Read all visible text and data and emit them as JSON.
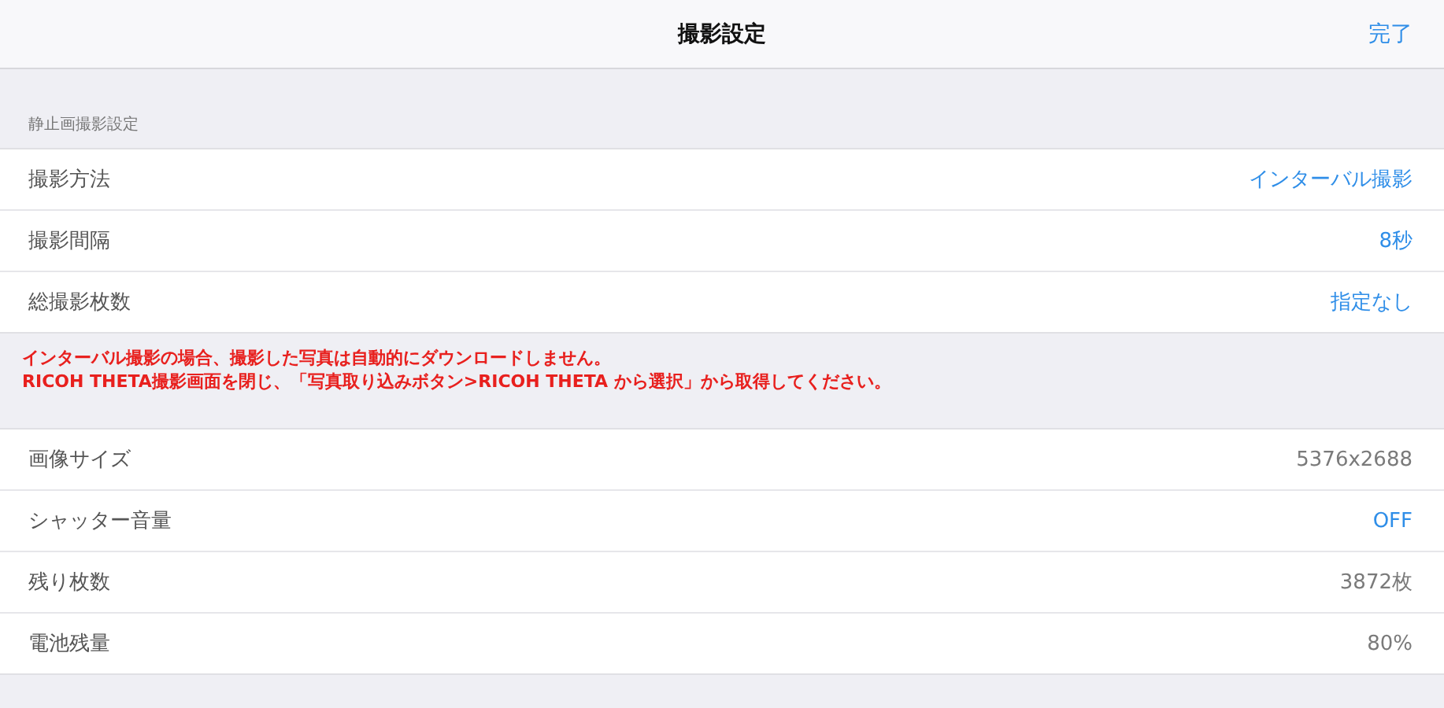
{
  "nav_bar": {
    "title": "撮影設定",
    "done_button": "完了"
  },
  "sections": [
    {
      "header": "静止画撮影設定",
      "rows": [
        {
          "label": "撮影方法",
          "value": "インターバル撮影",
          "kind": "editable"
        },
        {
          "label": "撮影間隔",
          "value": "8秒",
          "kind": "editable"
        },
        {
          "label": "総撮影枚数",
          "value": "指定なし",
          "kind": "editable"
        }
      ],
      "footer": [
        "インターバル撮影の場合、撮影した写真は自動的にダウンロードしません。",
        "RICOH THETA撮影画面を閉じ、「写真取り込みボタン>RICOH THETA から選択」から取得してください。"
      ]
    },
    {
      "rows": [
        {
          "label": "画像サイズ",
          "value": "5376x2688",
          "kind": "readonly"
        },
        {
          "label": "シャッター音量",
          "value": "OFF",
          "kind": "editable"
        },
        {
          "label": "残り枚数",
          "value": "3872枚",
          "kind": "readonly"
        },
        {
          "label": "電池残量",
          "value": "80%",
          "kind": "readonly"
        }
      ]
    }
  ]
}
